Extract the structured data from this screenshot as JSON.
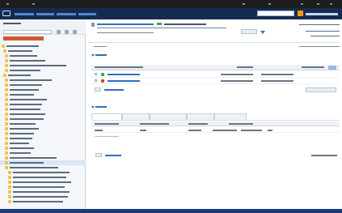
{
  "colors": {
    "os_bar": "#1e1e1e",
    "header": "#152b52",
    "accent_blue": "#2f6fbf",
    "accent_orange": "#f39c12",
    "danger_red": "#d0582e",
    "success_green": "#3aa257",
    "sidebar_bg": "#f4f6f9",
    "footer": "#1b3b78"
  },
  "icons": [
    "logo-icon",
    "search-icon",
    "folder-icon",
    "file-icon",
    "caret-down-icon",
    "checkbox-icon",
    "user-icon",
    "settings-icon"
  ]
}
